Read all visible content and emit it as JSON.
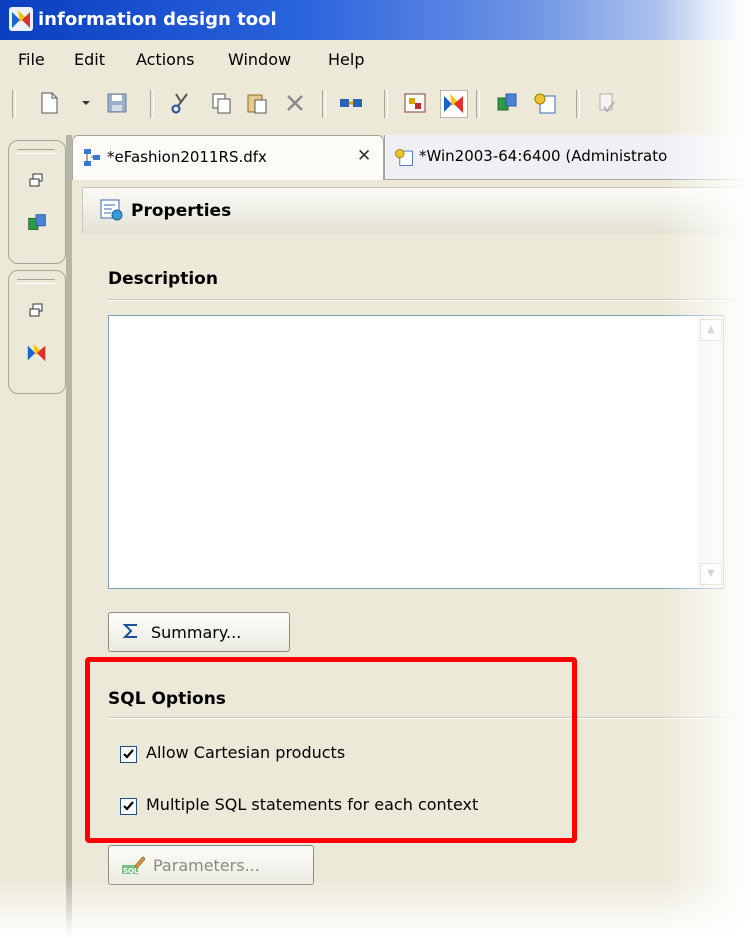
{
  "window": {
    "title": "information design tool",
    "accent": "#ff0000"
  },
  "menu": [
    "File",
    "Edit",
    "Actions",
    "Window",
    "Help"
  ],
  "toolbar": {
    "icons": [
      "new-icon",
      "dropdown-arrow-icon",
      "save-icon",
      "cut-icon",
      "copy-icon",
      "paste-icon",
      "delete-icon",
      "publish-icon",
      "business-layer-icon",
      "data-foundation-icon",
      "connection-icon",
      "project-icon",
      "check-integrity-icon"
    ]
  },
  "tabs": [
    {
      "label": "*eFashion2011RS.dfx",
      "active": true
    },
    {
      "label": "*Win2003-64:6400 (Administrato",
      "active": false
    }
  ],
  "panel": {
    "title": "Properties",
    "description": {
      "heading": "Description",
      "value": ""
    },
    "summary_button": "Summary...",
    "sql_options": {
      "heading": "SQL Options",
      "options": [
        {
          "label": "Allow Cartesian products",
          "checked": true
        },
        {
          "label": "Multiple SQL statements for each context",
          "checked": true
        }
      ]
    },
    "parameters_button": "Parameters..."
  }
}
